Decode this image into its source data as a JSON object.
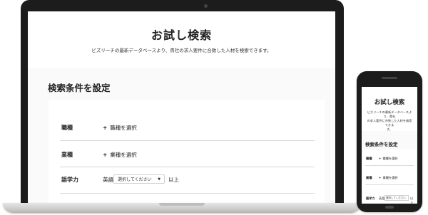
{
  "hero": {
    "title": "お試し検索",
    "subtitle": "ビズリーチの最新データベースより、貴社の求人要件に合致した人材を検索できます。"
  },
  "criteria": {
    "title": "検索条件を設定",
    "job_type": {
      "label": "職種",
      "action": "職種を選択"
    },
    "industry": {
      "label": "業種",
      "action": "業種を選択"
    },
    "language": {
      "label": "語学力",
      "language_name": "英語",
      "select_value": "選択してください",
      "level_suffix": "以上"
    }
  },
  "mobile": {
    "title": "お試し検索",
    "subtitle_line1": "ビズリーチの最新データベースより、貴社",
    "subtitle_line2": "の求人要件に合致した人材を検索できま",
    "subtitle_line3": "す。",
    "criteria_title": "検索条件を設定",
    "job_type_label": "職種",
    "job_type_action": "職種を選択",
    "industry_label": "業種",
    "industry_action": "業種を選択",
    "language_label": "語学力",
    "language_name": "英語",
    "select_value": "選択してください",
    "level_suffix": "以上"
  },
  "icons": {
    "plus": "+",
    "caret": "▼"
  },
  "colors": {
    "device_frame": "#1c1c1c",
    "page_background": "#fafafa",
    "card_background": "#ffffff"
  }
}
